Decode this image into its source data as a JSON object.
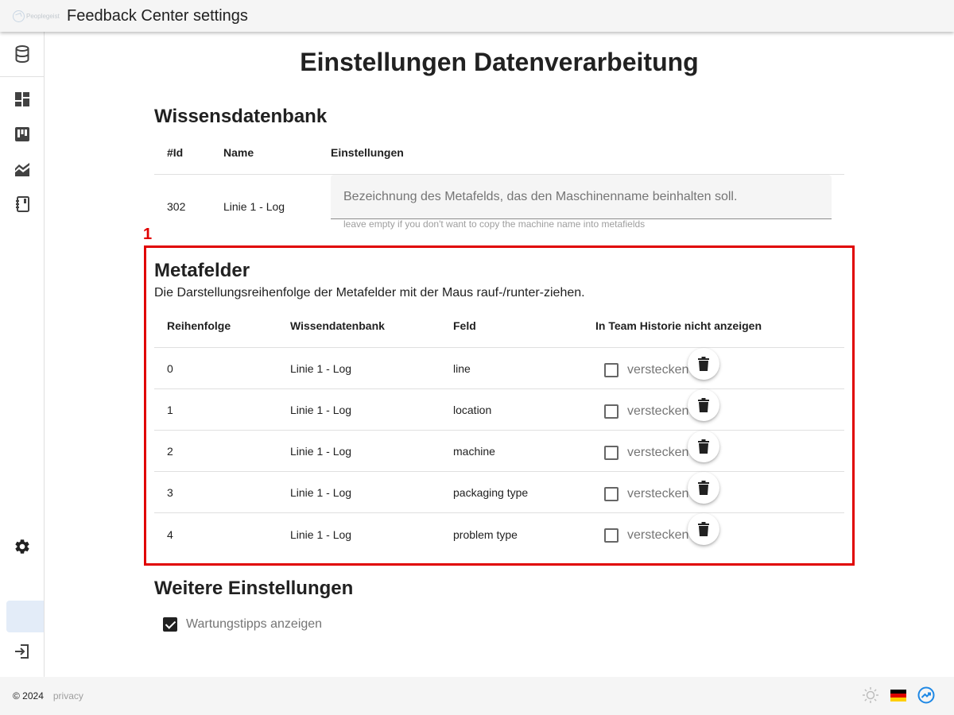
{
  "header": {
    "logo_text": "Peoplegeist",
    "title": "Feedback Center settings"
  },
  "sidebar": {
    "items": [
      {
        "icon": "database-icon"
      },
      {
        "icon": "dashboard-icon"
      },
      {
        "icon": "board-icon"
      },
      {
        "icon": "analytics-icon"
      },
      {
        "icon": "notebook-icon"
      },
      {
        "icon": "gear-icon"
      },
      {
        "icon": "active-item"
      },
      {
        "icon": "logout-icon"
      }
    ]
  },
  "main": {
    "title": "Einstellungen Datenverarbeitung",
    "knowledge_base": {
      "title": "Wissensdatenbank",
      "headers": {
        "id": "#Id",
        "name": "Name",
        "settings": "Einstellungen"
      },
      "rows": [
        {
          "id": "302",
          "name": "Linie 1 - Log",
          "placeholder": "Bezeichnung des Metafelds, das den Maschinenname beinhalten soll.",
          "value": "",
          "hint": "leave empty if you don't want to copy the machine name into metafields"
        }
      ]
    },
    "annotation": {
      "number": "1",
      "color": "#e00000"
    },
    "metafields": {
      "title": "Metafelder",
      "subtitle": "Die Darstellungsreihenfolge der Metafelder mit der Maus rauf-/runter-ziehen.",
      "headers": {
        "order": "Reihenfolge",
        "knowledge_base": "Wissendatenbank",
        "field": "Feld",
        "hide": "In Team Historie nicht anzeigen"
      },
      "rows": [
        {
          "order": "0",
          "knowledge_base": "Linie 1 - Log",
          "field": "line",
          "hide_label": "verstecken",
          "hidden": false
        },
        {
          "order": "1",
          "knowledge_base": "Linie 1 - Log",
          "field": "location",
          "hide_label": "verstecken",
          "hidden": false
        },
        {
          "order": "2",
          "knowledge_base": "Linie 1 - Log",
          "field": "machine",
          "hide_label": "verstecken",
          "hidden": false
        },
        {
          "order": "3",
          "knowledge_base": "Linie 1 - Log",
          "field": "packaging type",
          "hide_label": "verstecken",
          "hidden": false
        },
        {
          "order": "4",
          "knowledge_base": "Linie 1 - Log",
          "field": "problem type",
          "hide_label": "verstecken",
          "hidden": false
        }
      ]
    },
    "further": {
      "title": "Weitere Einstellungen",
      "maintenance_tips_label": "Wartungstipps anzeigen",
      "maintenance_tips_checked": true
    }
  },
  "footer": {
    "copyright": "© 2024",
    "privacy": "privacy",
    "icons": [
      "theme-icon",
      "german-flag-icon",
      "app-logo-icon"
    ]
  },
  "colors": {
    "accent": "#1e88e5",
    "annotation": "#e00000",
    "active_nav": "#e3ecf8"
  }
}
